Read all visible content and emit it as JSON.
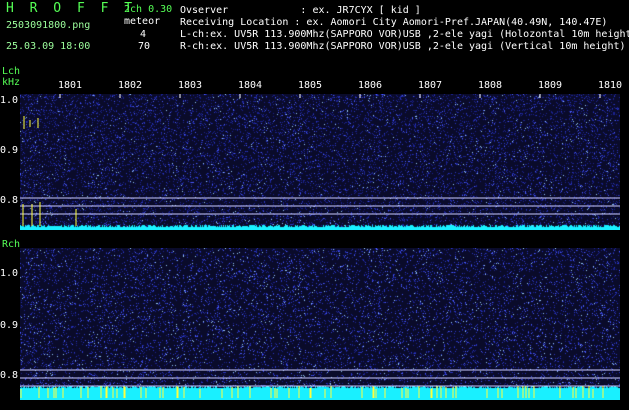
{
  "header": {
    "app_letters": "H R O F F T",
    "filename": "2503091800.png",
    "datetime": "25.03.09 18:00",
    "channel_mode": "2ch 0.30",
    "meteor_label": "meteor",
    "lch_count": "4",
    "rch_count": "70",
    "info_lines": [
      "Ovserver            : ex. JR7CYX [ kid ]",
      "Receiving Location : ex. Aomori City Aomori-Pref.JAPAN(40.49N, 140.47E)",
      "L-ch:ex. UV5R 113.900Mhz(SAPPORO VOR)USB ,2-ele yagi (Holozontal 10m height)",
      "R-ch:ex. UV5R 113.900Mhz(SAPPORO VOR)USB ,2-ele yagi (Vertical 10m height)"
    ]
  },
  "lch": {
    "label": "Lch",
    "unit": "kHz",
    "y_ticks": [
      "1.0",
      "0.9",
      "0.8"
    ]
  },
  "rch": {
    "label": "Rch",
    "y_ticks": [
      "1.0",
      "0.9",
      "0.8"
    ]
  },
  "time_ticks": [
    "1801",
    "1802",
    "1803",
    "1804",
    "1805",
    "1806",
    "1807",
    "1808",
    "1809",
    "1810"
  ],
  "colors": {
    "background": "#000000",
    "noise_dark": "#0a0b2a",
    "noise_blue": "#2a37c8",
    "baseline_cyan": "#19f0ff",
    "meteor_yellow": "#ffff3c",
    "header_green": "#55ff55"
  }
}
